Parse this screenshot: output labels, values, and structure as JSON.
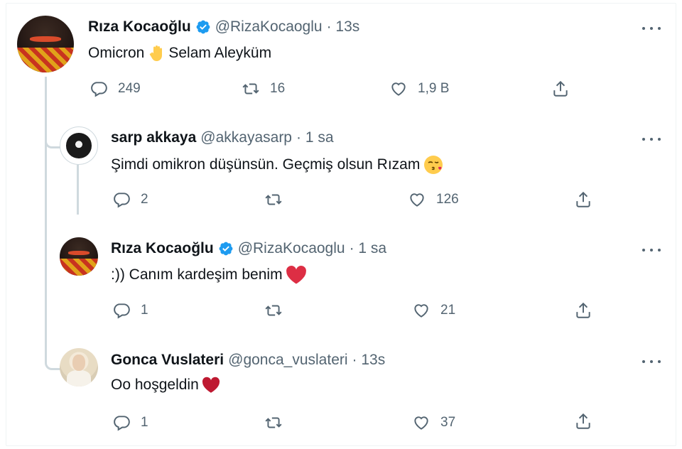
{
  "tweets": [
    {
      "name": "Rıza Kocaoğlu",
      "verified": true,
      "handle": "@RizaKocaoglu",
      "time": "· 13s",
      "text": "Omicron",
      "text_emoji": "raised-hand-icon",
      "text_after": "Selam Aleyküm",
      "replies": "249",
      "retweets": "16",
      "likes": "1,9 B"
    },
    {
      "name": "sarp akkaya",
      "verified": false,
      "handle": "@akkayasarp",
      "time": "· 1 sa",
      "text": "Şimdi omikron düşünsün. Geçmiş olsun Rızam",
      "text_emoji": "kiss-face-icon",
      "replies": "2",
      "retweets": "",
      "likes": "126"
    },
    {
      "name": "Rıza Kocaoğlu",
      "verified": true,
      "handle": "@RizaKocaoglu",
      "time": "· 1 sa",
      "text": ":)) Canım kardeşim benim",
      "text_emoji": "red-heart-icon",
      "replies": "1",
      "retweets": "",
      "likes": "21"
    },
    {
      "name": "Gonca Vuslateri",
      "verified": false,
      "handle": "@gonca_vuslateri",
      "time": "· 13s",
      "text": "Oo hoşgeldin",
      "text_emoji": "red-heart-icon",
      "replies": "1",
      "retweets": "",
      "likes": "37"
    }
  ],
  "colors": {
    "text": "#0f1419",
    "secondary": "#536471",
    "verified": "#1d9bf0",
    "heart": "#e0245e",
    "thread_line": "#cfd9de"
  }
}
